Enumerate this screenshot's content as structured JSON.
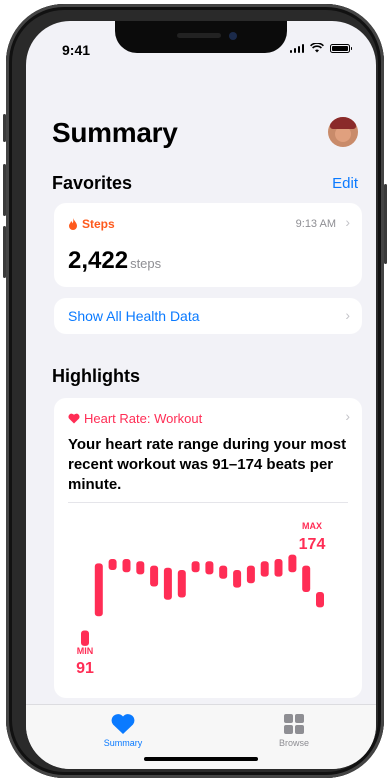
{
  "status": {
    "time": "9:41"
  },
  "header": {
    "title": "Summary"
  },
  "favorites": {
    "heading": "Favorites",
    "edit_label": "Edit",
    "steps": {
      "label": "Steps",
      "time": "9:13 AM",
      "value": "2,422",
      "unit": "steps"
    },
    "show_all": "Show All Health Data"
  },
  "highlights": {
    "heading": "Highlights",
    "heart_rate": {
      "label": "Heart Rate: Workout",
      "text": "Your heart rate range during your most recent workout was 91–174 beats per minute.",
      "max_label": "MAX",
      "max_value": "174",
      "min_label": "MIN",
      "min_value": "91"
    }
  },
  "tabbar": {
    "summary": "Summary",
    "browse": "Browse"
  },
  "colors": {
    "accent": "#0a7aff",
    "heart": "#ff2d55",
    "steps": "#fe5a1d"
  },
  "chart_data": {
    "type": "bar",
    "description_values": "heart-rate ranges per interval (bpm)",
    "ranges": [
      [
        91,
        105
      ],
      [
        118,
        166
      ],
      [
        160,
        170
      ],
      [
        158,
        170
      ],
      [
        156,
        168
      ],
      [
        145,
        164
      ],
      [
        133,
        162
      ],
      [
        135,
        160
      ],
      [
        158,
        168
      ],
      [
        156,
        168
      ],
      [
        152,
        164
      ],
      [
        144,
        160
      ],
      [
        148,
        164
      ],
      [
        154,
        168
      ],
      [
        154,
        170
      ],
      [
        158,
        174
      ],
      [
        140,
        164
      ],
      [
        126,
        140
      ]
    ],
    "ylim": [
      80,
      180
    ]
  }
}
